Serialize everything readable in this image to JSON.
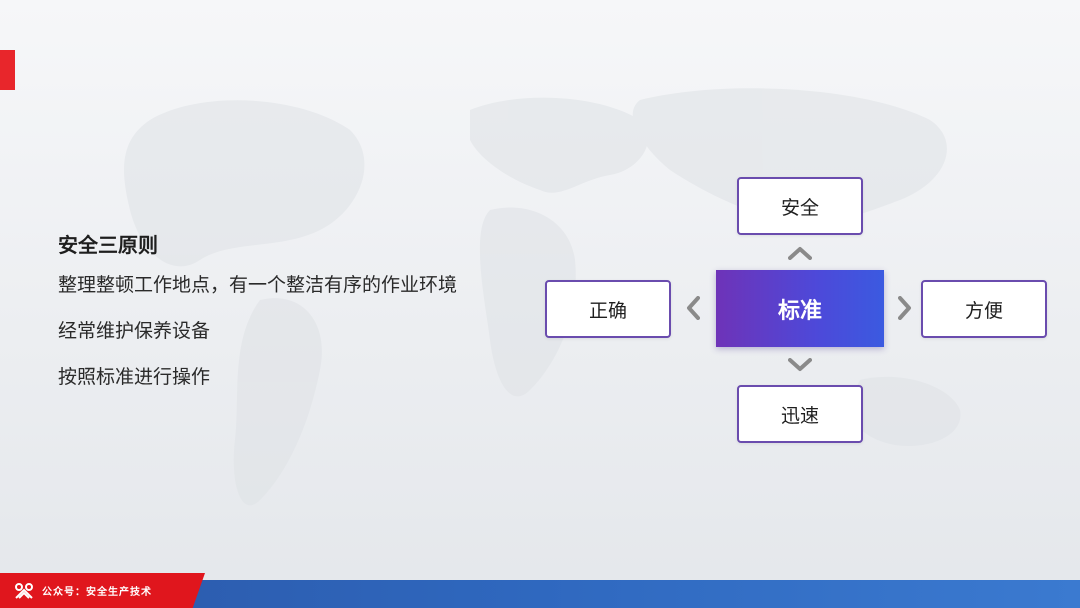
{
  "slide": {
    "heading": "安全三原则",
    "lines": [
      "整理整顿工作地点，有一个整洁有序的作业环境",
      "经常维护保养设备",
      "按照标准进行操作"
    ]
  },
  "diagram": {
    "center": "标准",
    "top": "安全",
    "left": "正确",
    "right": "方便",
    "bottom": "迅速"
  },
  "footer": {
    "text": "公众号：安全生产技术"
  },
  "colors": {
    "accent_red": "#e8262b",
    "box_border": "#6a4cae",
    "center_gradient_start": "#6e33b8",
    "center_gradient_end": "#3b5ae0",
    "footer_blue": "#2f68bf",
    "chevron": "#8a8a8a"
  }
}
